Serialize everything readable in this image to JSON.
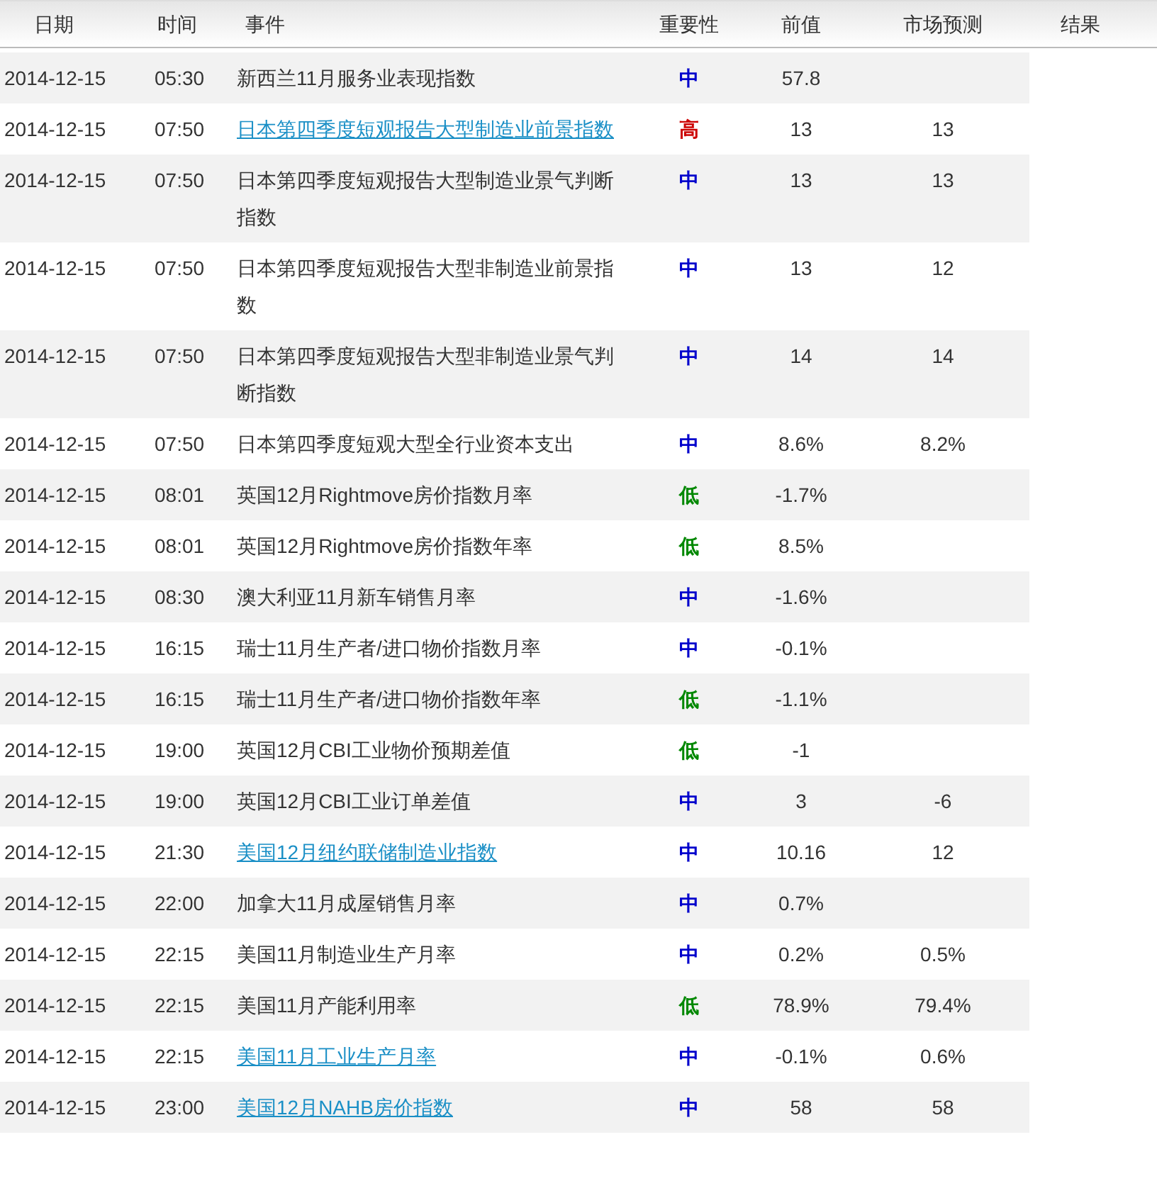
{
  "columns": [
    "日期",
    "时间",
    "事件",
    "重要性",
    "前值",
    "市场预测",
    "结果"
  ],
  "rows": [
    {
      "date": "2014-12-15",
      "time": "05:30",
      "event": "新西兰11月服务业表现指数",
      "link": false,
      "importance": "中",
      "color": "#0000cc",
      "previous": "57.8",
      "forecast": ""
    },
    {
      "date": "2014-12-15",
      "time": "07:50",
      "event": "日本第四季度短观报告大型制造业前景指数",
      "link": true,
      "importance": "高",
      "color": "#cc0000",
      "previous": "13",
      "forecast": "13"
    },
    {
      "date": "2014-12-15",
      "time": "07:50",
      "event": "日本第四季度短观报告大型制造业景气判断指数",
      "link": false,
      "importance": "中",
      "color": "#0000cc",
      "previous": "13",
      "forecast": "13"
    },
    {
      "date": "2014-12-15",
      "time": "07:50",
      "event": "日本第四季度短观报告大型非制造业前景指数",
      "link": false,
      "importance": "中",
      "color": "#0000cc",
      "previous": "13",
      "forecast": "12"
    },
    {
      "date": "2014-12-15",
      "time": "07:50",
      "event": "日本第四季度短观报告大型非制造业景气判断指数",
      "link": false,
      "importance": "中",
      "color": "#0000cc",
      "previous": "14",
      "forecast": "14"
    },
    {
      "date": "2014-12-15",
      "time": "07:50",
      "event": "日本第四季度短观大型全行业资本支出",
      "link": false,
      "importance": "中",
      "color": "#0000cc",
      "previous": "8.6%",
      "forecast": "8.2%"
    },
    {
      "date": "2014-12-15",
      "time": "08:01",
      "event": "英国12月Rightmove房价指数月率",
      "link": false,
      "importance": "低",
      "color": "#008800",
      "previous": "-1.7%",
      "forecast": ""
    },
    {
      "date": "2014-12-15",
      "time": "08:01",
      "event": "英国12月Rightmove房价指数年率",
      "link": false,
      "importance": "低",
      "color": "#008800",
      "previous": "8.5%",
      "forecast": ""
    },
    {
      "date": "2014-12-15",
      "time": "08:30",
      "event": "澳大利亚11月新车销售月率",
      "link": false,
      "importance": "中",
      "color": "#0000cc",
      "previous": "-1.6%",
      "forecast": ""
    },
    {
      "date": "2014-12-15",
      "time": "16:15",
      "event": "瑞士11月生产者/进口物价指数月率",
      "link": false,
      "importance": "中",
      "color": "#0000cc",
      "previous": "-0.1%",
      "forecast": ""
    },
    {
      "date": "2014-12-15",
      "time": "16:15",
      "event": "瑞士11月生产者/进口物价指数年率",
      "link": false,
      "importance": "低",
      "color": "#008800",
      "previous": "-1.1%",
      "forecast": ""
    },
    {
      "date": "2014-12-15",
      "time": "19:00",
      "event": "英国12月CBI工业物价预期差值",
      "link": false,
      "importance": "低",
      "color": "#008800",
      "previous": "-1",
      "forecast": ""
    },
    {
      "date": "2014-12-15",
      "time": "19:00",
      "event": "英国12月CBI工业订单差值",
      "link": false,
      "importance": "中",
      "color": "#0000cc",
      "previous": "3",
      "forecast": "-6"
    },
    {
      "date": "2014-12-15",
      "time": "21:30",
      "event": "美国12月纽约联储制造业指数",
      "link": true,
      "importance": "中",
      "color": "#0000cc",
      "previous": "10.16",
      "forecast": "12"
    },
    {
      "date": "2014-12-15",
      "time": "22:00",
      "event": "加拿大11月成屋销售月率",
      "link": false,
      "importance": "中",
      "color": "#0000cc",
      "previous": "0.7%",
      "forecast": ""
    },
    {
      "date": "2014-12-15",
      "time": "22:15",
      "event": "美国11月制造业生产月率",
      "link": false,
      "importance": "中",
      "color": "#0000cc",
      "previous": "0.2%",
      "forecast": "0.5%"
    },
    {
      "date": "2014-12-15",
      "time": "22:15",
      "event": "美国11月产能利用率",
      "link": false,
      "importance": "低",
      "color": "#008800",
      "previous": "78.9%",
      "forecast": "79.4%"
    },
    {
      "date": "2014-12-15",
      "time": "22:15",
      "event": "美国11月工业生产月率",
      "link": true,
      "importance": "中",
      "color": "#0000cc",
      "previous": "-0.1%",
      "forecast": "0.6%"
    },
    {
      "date": "2014-12-15",
      "time": "23:00",
      "event": "美国12月NAHB房价指数",
      "link": true,
      "importance": "中",
      "color": "#0000cc",
      "previous": "58",
      "forecast": "58"
    }
  ]
}
